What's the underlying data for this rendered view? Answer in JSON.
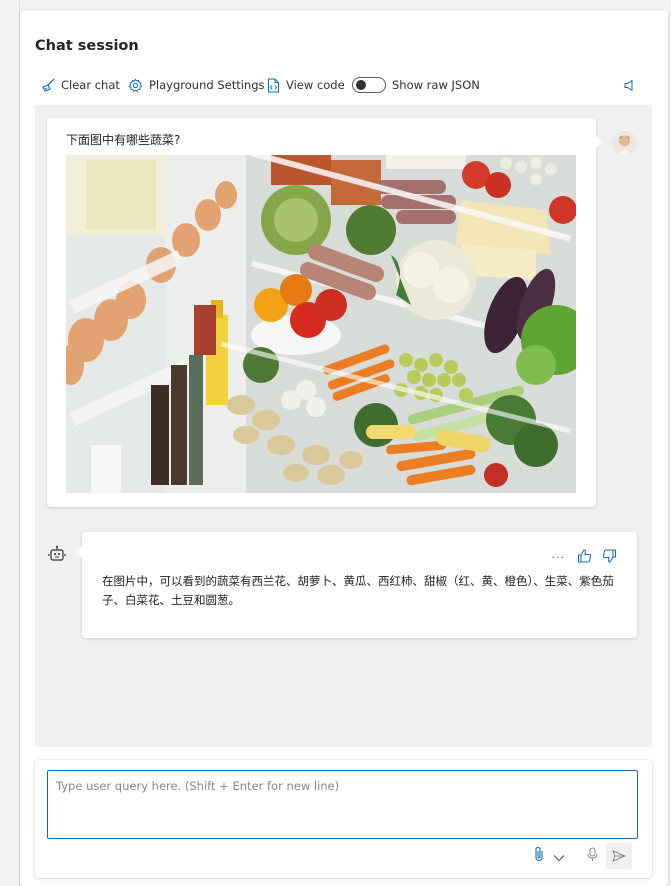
{
  "session": {
    "title": "Chat session"
  },
  "toolbar": {
    "clear_chat": "Clear chat",
    "playground_settings": "Playground Settings",
    "view_code": "View code",
    "show_raw_json": "Show raw JSON",
    "show_raw_json_enabled": false
  },
  "messages": {
    "user": {
      "text": "下面图中有哪些蔬菜?"
    },
    "assistant": {
      "text": "在图片中，可以看到的蔬菜有西兰花、胡萝卜、黄瓜、西红柿、甜椒（红、黄、橙色）、生菜、紫色茄子、白菜花、土豆和圆葱。"
    }
  },
  "input": {
    "placeholder": "Type user query here. (Shift + Enter for new line)",
    "value": ""
  },
  "colors": {
    "accent": "#0f6cbd",
    "panel_bg": "#ffffff",
    "chat_bg": "#f0f0f0"
  }
}
